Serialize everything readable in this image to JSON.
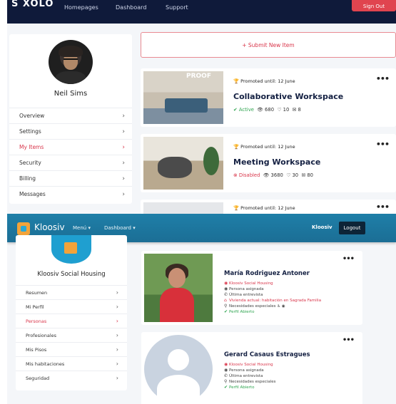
{
  "top": {
    "logo": "S XOLO",
    "nav": [
      "Homepages",
      "Dashboard",
      "Support"
    ],
    "cta": "Sign Out",
    "user_name": "Neil Sims",
    "menu": [
      {
        "label": "Overview"
      },
      {
        "label": "Settings"
      },
      {
        "label": "My Items",
        "active": true
      },
      {
        "label": "Security"
      },
      {
        "label": "Billing"
      },
      {
        "label": "Messages"
      }
    ],
    "submit_label": "+ Submit New Item",
    "items": [
      {
        "promo": "Promoted until: 12 June",
        "title": "Collaborative Workspace",
        "status": "Active",
        "views": "680",
        "likes": "10",
        "messages": "8",
        "thumb_text": "PROOF"
      },
      {
        "promo": "Promoted until: 12 June",
        "title": "Meeting Workspace",
        "status": "Disabled",
        "views": "3680",
        "likes": "30",
        "messages": "80"
      },
      {
        "promo": "Promoted until: 12 June"
      }
    ]
  },
  "bottom": {
    "brand": "Kloosiv",
    "nav": [
      "Menú ▾",
      "Dashboard ▾"
    ],
    "user": "Kloosiv",
    "logout": "Logout",
    "org_name": "Kloosiv Social Housing",
    "menu": [
      {
        "label": "Resumen"
      },
      {
        "label": "Mi Perfil"
      },
      {
        "label": "Personas",
        "active": true
      },
      {
        "label": "Profesionales"
      },
      {
        "label": "Mis Pisos"
      },
      {
        "label": "Mis habitaciones"
      },
      {
        "label": "Seguridad"
      }
    ],
    "people": [
      {
        "name": "María Rodriguez Antoner",
        "org": "Kloosiv Social Housing",
        "assigned": "Persona asignada",
        "last_interview": "Última entrevista",
        "housing": "Vivienda actual: habitación en Sagrada Familia",
        "needs": "Necesidades especiales",
        "status": "Perfil Abierto"
      },
      {
        "name": "Gerard Casaus Estragues",
        "org": "Kloosiv Social Housing",
        "assigned": "Persona asignada",
        "last_interview": "Última entrevista",
        "needs": "Necesidades especiales",
        "status": "Perfil Abierto"
      }
    ]
  }
}
